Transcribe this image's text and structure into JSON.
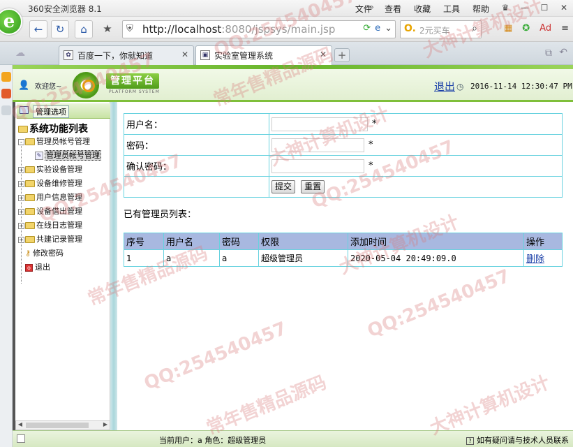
{
  "browser": {
    "title": "360安全浏览器 8.1",
    "menu": [
      "文件",
      "查看",
      "收藏",
      "工具",
      "帮助"
    ],
    "url_host": "http://localhost",
    "url_rest": ":8080/jspsys/main.jsp",
    "search_placeholder": "2元买车",
    "tabs": [
      {
        "label": "百度一下，你就知道"
      },
      {
        "label": "实验室管理系统"
      }
    ]
  },
  "header": {
    "welcome": "欢迎您~",
    "brand": "管理平台",
    "brand_sub": "PLATFORM SYSTEM",
    "logout": "退出",
    "datetime": "2016-11-14 12:30:47 PM"
  },
  "sidebar": {
    "options_button": "管理选项",
    "root": "系统功能列表",
    "items": [
      {
        "label": "管理员帐号管理",
        "expand": "-"
      },
      {
        "label": "实验设备管理",
        "expand": "+"
      },
      {
        "label": "设备维修管理",
        "expand": "+"
      },
      {
        "label": "用户信息管理",
        "expand": "+"
      },
      {
        "label": "设备借出管理",
        "expand": "+"
      },
      {
        "label": "在线日志管理",
        "expand": "+"
      },
      {
        "label": "共建记录管理",
        "expand": "+"
      }
    ],
    "sub_item": "管理员帐号管理",
    "change_password": "修改密码",
    "exit": "退出"
  },
  "form": {
    "username_label": "用户名：",
    "password_label": "密码：",
    "confirm_label": "确认密码：",
    "required_mark": "*",
    "submit": "提交",
    "reset": "重置"
  },
  "list": {
    "title": "已有管理员列表：",
    "headers": [
      "序号",
      "用户名",
      "密码",
      "权限",
      "添加时间",
      "操作"
    ],
    "rows": [
      {
        "id": "1",
        "username": "a",
        "password": "a",
        "role": "超级管理员",
        "time": "2020-05-04 20:49:09.0",
        "action": "删除"
      }
    ]
  },
  "status": {
    "current_user": "当前用户：a  角色：超级管理员",
    "help": "如有疑问请与技术人员联系"
  },
  "watermarks": [
    "QQ:254540457",
    "大神计算机设计",
    "常年售精品源码"
  ]
}
